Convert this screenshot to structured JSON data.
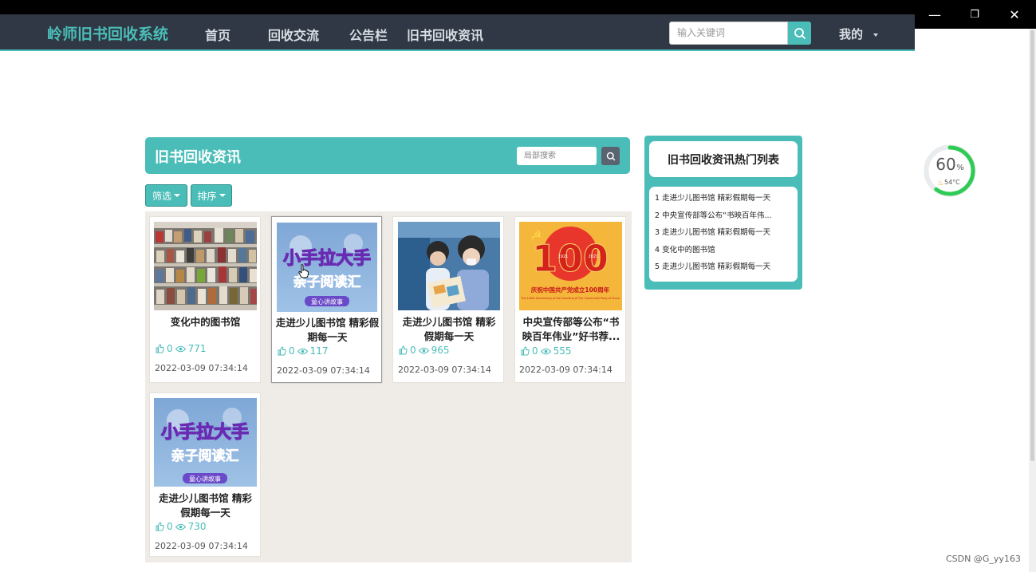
{
  "window": {
    "minimize": "—",
    "restore": "❐",
    "close": "✕"
  },
  "nav": {
    "brand": "岭师旧书回收系统",
    "links": [
      "首页",
      "回收交流",
      "公告栏",
      "旧书回收资讯"
    ],
    "search_placeholder": "输入关键词",
    "mine": "我的"
  },
  "section": {
    "title": "旧书回收资讯",
    "local_search_placeholder": "局部搜索",
    "filter_label": "筛选",
    "sort_label": "排序"
  },
  "cards": [
    {
      "title": "变化中的图书馆",
      "likes": "0",
      "views": "771",
      "date": "2022-03-09 07:34:14"
    },
    {
      "title": "走进少儿图书馆 精彩假期每一天",
      "likes": "0",
      "views": "117",
      "date": "2022-03-09 07:34:14"
    },
    {
      "title": "走进少儿图书馆 精彩假期每一天",
      "likes": "0",
      "views": "965",
      "date": "2022-03-09 07:34:14"
    },
    {
      "title": "中央宣传部等公布“书映百年伟业”好书荐...",
      "likes": "0",
      "views": "555",
      "date": "2022-03-09 07:34:14"
    },
    {
      "title": "走进少儿图书馆 精彩假期每一天",
      "likes": "0",
      "views": "730",
      "date": "2022-03-09 07:34:14"
    }
  ],
  "thumb_text": {
    "kids_title": "小手拉大手",
    "kids_sub": "亲子阅读汇",
    "kids_badge": "童心讲故事",
    "party_num": "100",
    "party_year1": "1921",
    "party_year2": "2021",
    "party_cn": "庆祝中国共产党成立100周年",
    "party_en": "The 100th Anniversary of the Founding of The Communist Party of China"
  },
  "hot": {
    "title": "旧书回收资讯热门列表",
    "items": [
      "1  走进少儿图书馆 精彩假期每一天",
      "2  中央宣传部等公布“书映百年伟...",
      "3  走进少儿图书馆 精彩假期每一天",
      "4  变化中的图书馆",
      "5  走进少儿图书馆 精彩假期每一天"
    ]
  },
  "gauge": {
    "percent": "60",
    "unit": "%",
    "temp": "54°C",
    "value": 60
  },
  "watermark": "CSDN @G_yy163",
  "colors": {
    "accent": "#4bbdb8",
    "navbar": "#2f3844"
  }
}
